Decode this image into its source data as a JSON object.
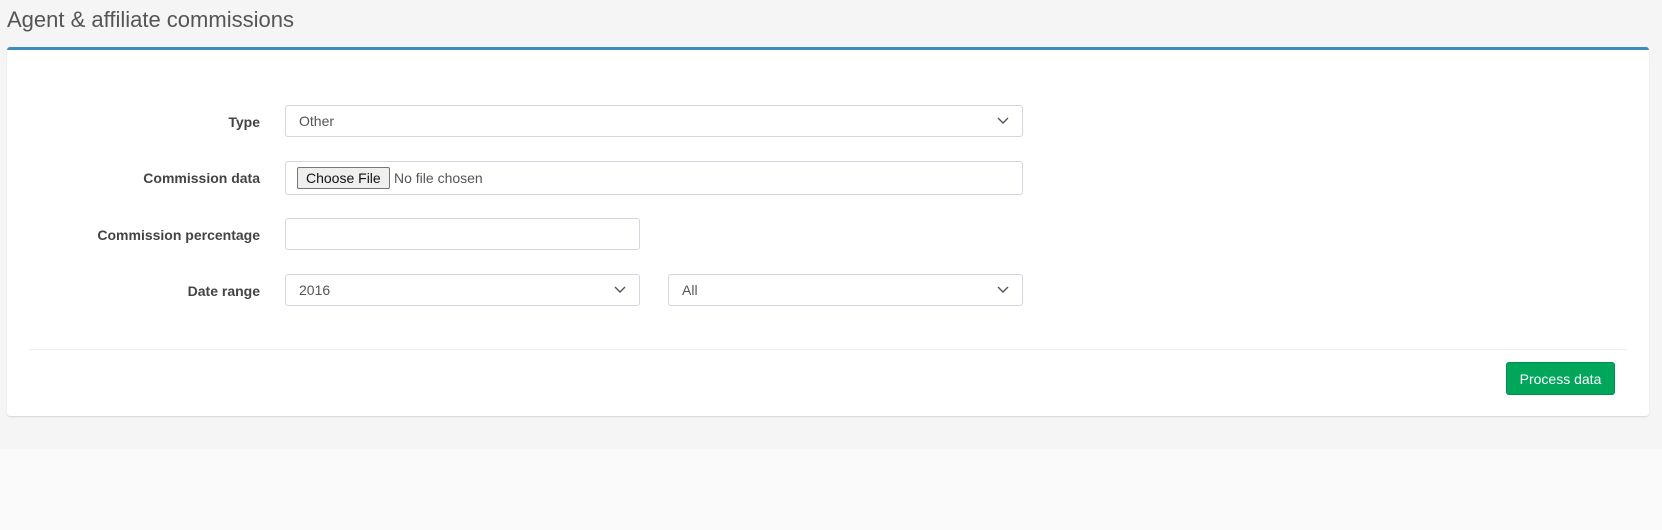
{
  "header": {
    "title": "Agent & affiliate commissions"
  },
  "form": {
    "type": {
      "label": "Type",
      "value": "Other"
    },
    "commission_data": {
      "label": "Commission data",
      "button_label": "Choose File",
      "status": "No file chosen"
    },
    "commission_percentage": {
      "label": "Commission percentage",
      "value": ""
    },
    "date_range": {
      "label": "Date range",
      "year": "2016",
      "period": "All"
    }
  },
  "footer": {
    "process_label": "Process data"
  },
  "colors": {
    "accent": "#3c8dbc",
    "success": "#00a65a"
  }
}
